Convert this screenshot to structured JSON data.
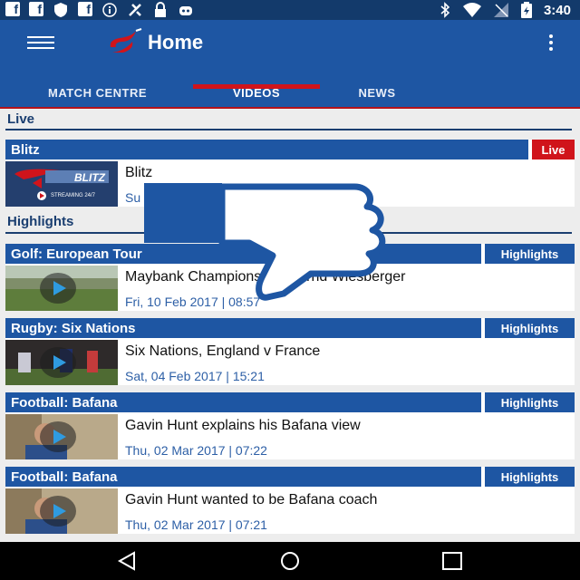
{
  "status_bar": {
    "time": "3:40",
    "left_icons": [
      "facebook-icon",
      "facebook-icon",
      "shield-icon",
      "facebook-icon",
      "info-icon",
      "fixit-icon",
      "lock-icon",
      "bot-icon"
    ],
    "right_icons": [
      "bluetooth-icon",
      "wifi-icon",
      "signal-icon",
      "battery-icon"
    ]
  },
  "app_bar": {
    "title": "Home",
    "tabs": [
      {
        "label": "MATCH CENTRE"
      },
      {
        "label": "VIDEOS"
      },
      {
        "label": "NEWS"
      }
    ],
    "active_tab": "VIDEOS"
  },
  "sections": {
    "live": {
      "label": "Live",
      "cards": [
        {
          "category": "Blitz",
          "badge": "Live",
          "title": "Blitz",
          "date": "Su",
          "thumb_text": "BLITZ",
          "thumb_subtext": "STREAMING 24/7"
        }
      ]
    },
    "highlights": {
      "label": "Highlights",
      "cards": [
        {
          "category": "Golf: European Tour",
          "badge": "Highlights",
          "title": "Maybank Championship: Bernd Wiesberger",
          "date": "Fri, 10 Feb 2017 | 08:57"
        },
        {
          "category": "Rugby: Six Nations",
          "badge": "Highlights",
          "title": "Six Nations, England v France",
          "date": "Sat, 04 Feb 2017 | 15:21"
        },
        {
          "category": "Football: Bafana",
          "badge": "Highlights",
          "title": "Gavin Hunt explains his Bafana view",
          "date": "Thu, 02 Mar 2017 | 07:22"
        },
        {
          "category": "Football: Bafana",
          "badge": "Highlights",
          "title": "Gavin Hunt wanted to be Bafana coach",
          "date": "Thu, 02 Mar 2017 | 07:21"
        }
      ]
    }
  },
  "colors": {
    "primary": "#1e56a3",
    "accent": "#d0141b",
    "date_text": "#2d5fa6",
    "status_bar": "#133a6b"
  },
  "overlay": {
    "icon": "thumbs-down-icon"
  }
}
